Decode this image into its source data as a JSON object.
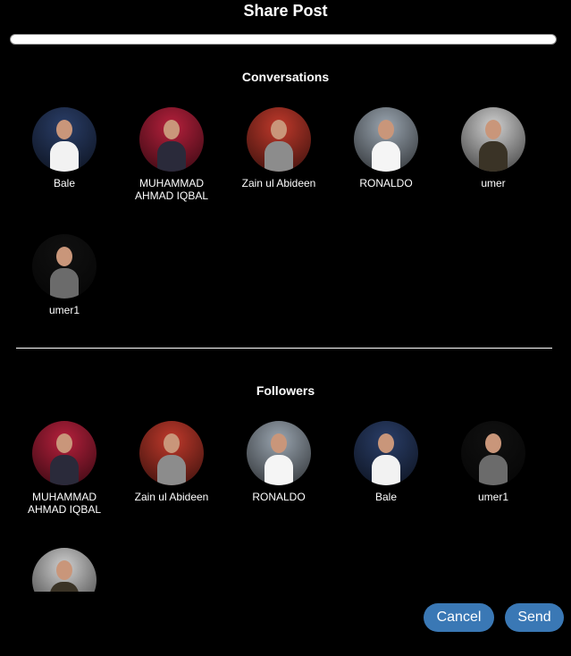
{
  "title": "Share Post",
  "search": {
    "value": "",
    "placeholder": ""
  },
  "conversations": {
    "heading": "Conversations",
    "users": [
      {
        "name": "Bale",
        "icon": "avatar-bale",
        "bg": "#2a3e68",
        "shirt": "#f2f2f2"
      },
      {
        "name": "MUHAMMAD AHMAD IQBAL",
        "icon": "avatar-muhammad",
        "bg": "#b6203c",
        "shirt": "#2a2a3a"
      },
      {
        "name": "Zain ul Abideen",
        "icon": "avatar-zain",
        "bg": "#c0392b",
        "shirt": "#8c8c8c"
      },
      {
        "name": "RONALDO",
        "icon": "avatar-ronaldo",
        "bg": "#9aa5b0",
        "shirt": "#f5f5f5"
      },
      {
        "name": "umer",
        "icon": "avatar-umer",
        "bg": "#d0d0d0",
        "shirt": "#3a3326"
      },
      {
        "name": "umer1",
        "icon": "avatar-umer1",
        "bg": "#111111",
        "shirt": "#6b6b6b"
      }
    ]
  },
  "followers": {
    "heading": "Followers",
    "users": [
      {
        "name": "MUHAMMAD AHMAD IQBAL",
        "icon": "avatar-muhammad",
        "bg": "#b6203c",
        "shirt": "#2a2a3a"
      },
      {
        "name": "Zain ul Abideen",
        "icon": "avatar-zain",
        "bg": "#c0392b",
        "shirt": "#8c8c8c"
      },
      {
        "name": "RONALDO",
        "icon": "avatar-ronaldo",
        "bg": "#9aa5b0",
        "shirt": "#f5f5f5"
      },
      {
        "name": "Bale",
        "icon": "avatar-bale",
        "bg": "#2a3e68",
        "shirt": "#f2f2f2"
      },
      {
        "name": "umer1",
        "icon": "avatar-umer1",
        "bg": "#111111",
        "shirt": "#6b6b6b"
      },
      {
        "name": "",
        "icon": "avatar-umer",
        "bg": "#d0d0d0",
        "shirt": "#3a3326"
      }
    ]
  },
  "actions": {
    "cancel_label": "Cancel",
    "send_label": "Send",
    "accent": "#3a78b5"
  }
}
